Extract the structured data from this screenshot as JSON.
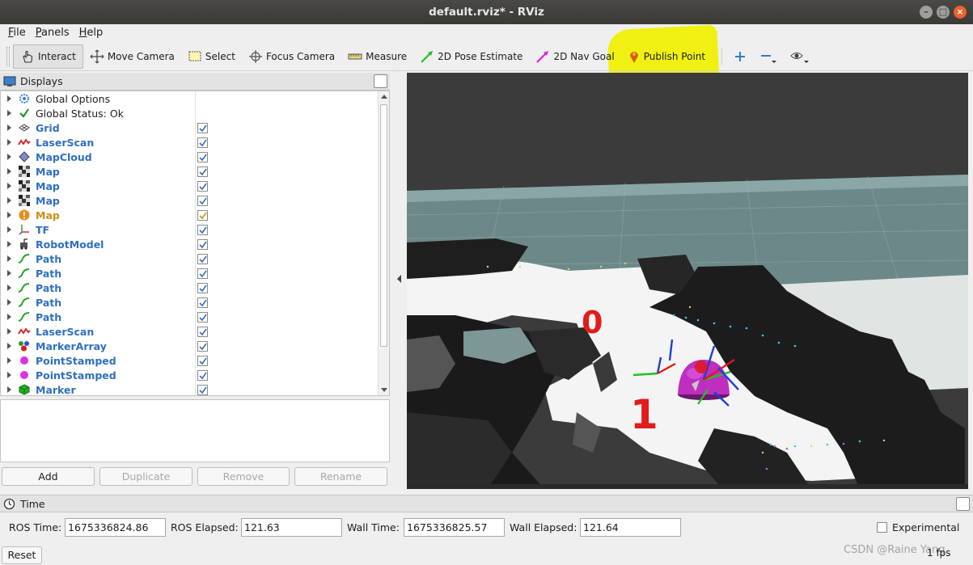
{
  "window": {
    "title": "default.rviz* - RViz"
  },
  "menubar": {
    "items": [
      {
        "label": "File",
        "mnemonic": "F",
        "rest": "ile"
      },
      {
        "label": "Panels",
        "mnemonic": "P",
        "rest": "anels"
      },
      {
        "label": "Help",
        "mnemonic": "H",
        "rest": "elp"
      }
    ]
  },
  "toolbar": {
    "interact": "Interact",
    "move_camera": "Move Camera",
    "select": "Select",
    "focus_camera": "Focus Camera",
    "measure": "Measure",
    "pose_estimate": "2D Pose Estimate",
    "nav_goal": "2D Nav Goal",
    "publish_point": "Publish Point"
  },
  "displays": {
    "title": "Displays",
    "items": [
      {
        "label": "Global Options",
        "icon": "gear-icon",
        "style": "plain",
        "checked": null
      },
      {
        "label": "Global Status: Ok",
        "icon": "checkmark-icon",
        "style": "plain",
        "checked": null
      },
      {
        "label": "Grid",
        "icon": "grid-icon",
        "style": "blue",
        "checked": true
      },
      {
        "label": "LaserScan",
        "icon": "laserscan-icon",
        "style": "blue",
        "checked": true
      },
      {
        "label": "MapCloud",
        "icon": "pointcloud-icon",
        "style": "blue",
        "checked": true
      },
      {
        "label": "Map",
        "icon": "map-icon",
        "style": "blue",
        "checked": true
      },
      {
        "label": "Map",
        "icon": "map-icon",
        "style": "blue",
        "checked": true
      },
      {
        "label": "Map",
        "icon": "map-icon",
        "style": "blue",
        "checked": true
      },
      {
        "label": "Map",
        "icon": "warning-icon",
        "style": "orange",
        "checked": true
      },
      {
        "label": "TF",
        "icon": "tf-icon",
        "style": "blue",
        "checked": true
      },
      {
        "label": "RobotModel",
        "icon": "robot-icon",
        "style": "blue",
        "checked": true
      },
      {
        "label": "Path",
        "icon": "path-icon",
        "style": "blue",
        "checked": true
      },
      {
        "label": "Path",
        "icon": "path-icon",
        "style": "blue",
        "checked": true
      },
      {
        "label": "Path",
        "icon": "path-icon",
        "style": "blue",
        "checked": true
      },
      {
        "label": "Path",
        "icon": "path-icon",
        "style": "blue",
        "checked": true
      },
      {
        "label": "Path",
        "icon": "path-icon",
        "style": "blue",
        "checked": true
      },
      {
        "label": "LaserScan",
        "icon": "laserscan-icon",
        "style": "blue",
        "checked": true
      },
      {
        "label": "MarkerArray",
        "icon": "markerarray-icon",
        "style": "blue",
        "checked": true
      },
      {
        "label": "PointStamped",
        "icon": "point-icon",
        "style": "blue",
        "checked": true
      },
      {
        "label": "PointStamped",
        "icon": "point-icon",
        "style": "blue",
        "checked": true
      },
      {
        "label": "Marker",
        "icon": "cube-icon",
        "style": "blue",
        "checked": true
      }
    ],
    "buttons": {
      "add": "Add",
      "duplicate": "Duplicate",
      "remove": "Remove",
      "rename": "Rename"
    }
  },
  "viewport": {
    "labels": [
      "0",
      "1"
    ]
  },
  "time": {
    "title": "Time",
    "ros_time_label": "ROS Time:",
    "ros_time": "1675336824.86",
    "ros_elapsed_label": "ROS Elapsed:",
    "ros_elapsed": "121.63",
    "wall_time_label": "Wall Time:",
    "wall_time": "1675336825.57",
    "wall_elapsed_label": "Wall Elapsed:",
    "wall_elapsed": "121.64",
    "experimental_label": "Experimental",
    "experimental_checked": false,
    "reset": "Reset",
    "fps": "1 fps"
  },
  "watermark": "CSDN @Raine Yang",
  "colors": {
    "display_blue": "#2f6fbf",
    "warning_orange": "#c99016",
    "highlight_yellow": "#f0f000",
    "titlebar": "#3a3936"
  }
}
